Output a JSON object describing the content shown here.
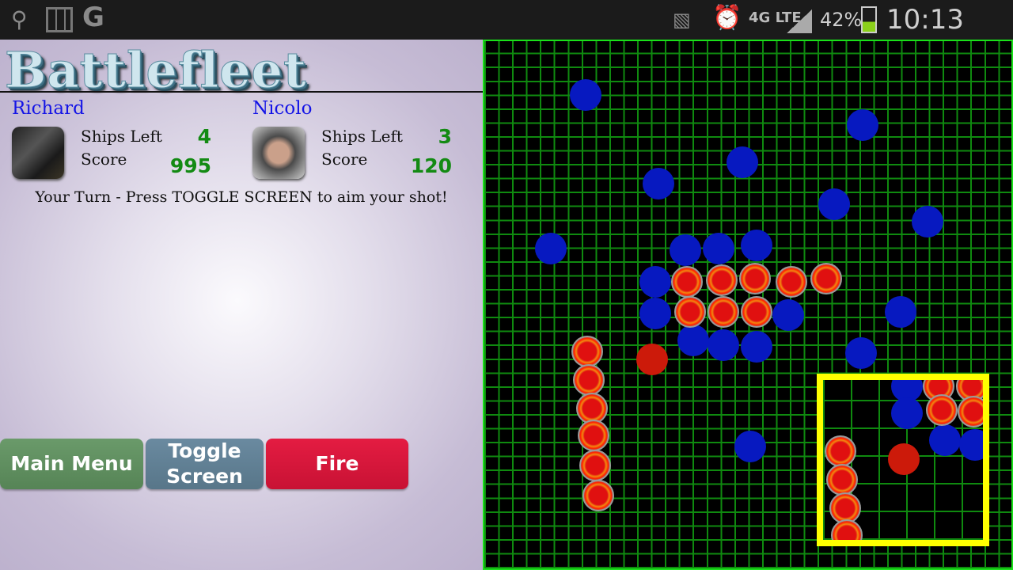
{
  "status_bar": {
    "icons": [
      "usb-icon",
      "screenshot-icon",
      "google-icon",
      "no-sim-icon",
      "alarm-icon",
      "4g-lte-icon",
      "signal-icon",
      "battery-charging-icon"
    ],
    "network": "4G LTE",
    "battery": "42%",
    "time": "10:13 AM"
  },
  "app": {
    "title": "Battlefleet"
  },
  "players": [
    {
      "name": "Richard",
      "ships_label": "Ships Left",
      "ships_left": "4",
      "score_label": "Score",
      "score": "995"
    },
    {
      "name": "Nicolo",
      "ships_label": "Ships Left",
      "ships_left": "3",
      "score_label": "Score",
      "score": "120"
    }
  ],
  "message": "Your Turn - Press TOGGLE SCREEN to aim your shot!",
  "buttons": {
    "main_menu": "Main Menu",
    "toggle_screen": "Toggle Screen",
    "fire": "Fire"
  },
  "colors": {
    "grid": "#0f8a0f",
    "board_border": "#19e019",
    "miss_marker": "#0719c0",
    "hit_marker": "#cc1a0a",
    "aim_box": "#ffff00",
    "main_menu": "#5f8f5f",
    "toggle": "#5f7f95",
    "fire": "#d8163a",
    "player_name": "#1414e6",
    "stat_value": "#138a13"
  }
}
